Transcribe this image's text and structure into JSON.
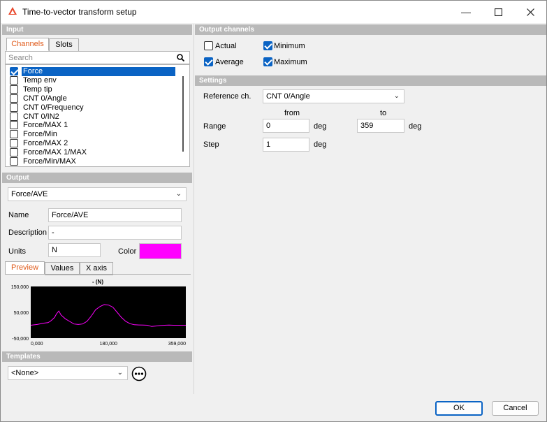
{
  "window": {
    "title": "Time-to-vector transform setup"
  },
  "input": {
    "header": "Input",
    "tabs": [
      "Channels",
      "Slots"
    ],
    "search_placeholder": "Search",
    "channels": [
      {
        "label": "Force",
        "checked": true,
        "selected": true
      },
      {
        "label": "Temp env",
        "checked": false
      },
      {
        "label": "Temp tip",
        "checked": false
      },
      {
        "label": "CNT 0/Angle",
        "checked": false
      },
      {
        "label": "CNT 0/Frequency",
        "checked": false
      },
      {
        "label": "CNT 0/IN2",
        "checked": false
      },
      {
        "label": "Force/MAX 1",
        "checked": false
      },
      {
        "label": "Force/Min",
        "checked": false
      },
      {
        "label": "Force/MAX 2",
        "checked": false
      },
      {
        "label": "Force/MAX 1/MAX",
        "checked": false
      },
      {
        "label": "Force/Min/MAX",
        "checked": false
      }
    ]
  },
  "output": {
    "header": "Output",
    "selected": "Force/AVE",
    "name_label": "Name",
    "name_value": "Force/AVE",
    "description_label": "Description",
    "description_value": "-",
    "units_label": "Units",
    "units_value": "N",
    "color_label": "Color",
    "color_value": "#ff00ff",
    "tabs": [
      "Preview",
      "Values",
      "X axis"
    ]
  },
  "preview": {
    "title": "- (N)",
    "y_ticks": [
      "150,000",
      "50,000",
      "-50,000"
    ],
    "x_ticks": [
      "0,000",
      "180,000",
      "359,000"
    ]
  },
  "chart_data": {
    "type": "line",
    "title": "- (N)",
    "xlim": [
      0,
      359
    ],
    "ylim": [
      -50000,
      150000
    ],
    "line_color": "#ff00ff",
    "background": "#000000",
    "x": [
      0,
      15,
      30,
      40,
      45,
      50,
      55,
      60,
      65,
      70,
      80,
      90,
      100,
      110,
      120,
      130,
      140,
      150,
      160,
      170,
      180,
      190,
      200,
      210,
      220,
      230,
      240,
      250,
      260,
      270,
      280,
      290,
      300,
      310,
      320,
      330,
      340,
      350,
      359
    ],
    "y": [
      0,
      3000,
      8000,
      10000,
      15000,
      22000,
      30000,
      45000,
      55000,
      40000,
      25000,
      15000,
      5000,
      3000,
      5000,
      15000,
      35000,
      60000,
      72000,
      80000,
      78000,
      70000,
      50000,
      30000,
      15000,
      6000,
      2000,
      1000,
      500,
      0,
      -5000,
      -3000,
      -1000,
      0,
      500,
      0,
      0,
      0,
      0
    ]
  },
  "templates": {
    "header": "Templates",
    "selected": "<None>"
  },
  "output_channels": {
    "header": "Output channels",
    "options": [
      {
        "label": "Actual",
        "checked": false
      },
      {
        "label": "Minimum",
        "checked": true
      },
      {
        "label": "Average",
        "checked": true
      },
      {
        "label": "Maximum",
        "checked": true
      }
    ]
  },
  "settings": {
    "header": "Settings",
    "reference_label": "Reference ch.",
    "reference_value": "CNT 0/Angle",
    "from_label": "from",
    "to_label": "to",
    "range_label": "Range",
    "range_from": "0",
    "range_to": "359",
    "step_label": "Step",
    "step_value": "1",
    "unit": "deg"
  },
  "buttons": {
    "ok": "OK",
    "cancel": "Cancel"
  }
}
